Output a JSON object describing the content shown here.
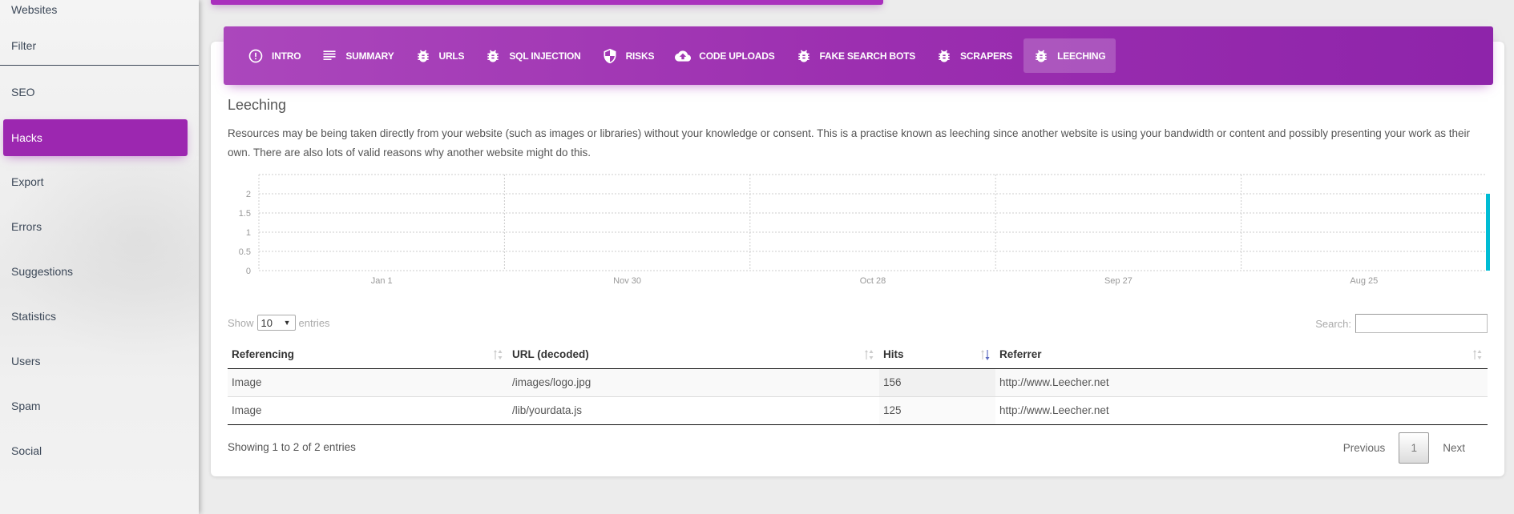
{
  "sidebar": {
    "items": [
      {
        "label": "Websites",
        "active": false
      },
      {
        "label": "Filter",
        "active": false
      },
      {
        "label": "SEO",
        "active": false
      },
      {
        "label": "Hacks",
        "active": true
      },
      {
        "label": "Export",
        "active": false
      },
      {
        "label": "Errors",
        "active": false
      },
      {
        "label": "Suggestions",
        "active": false
      },
      {
        "label": "Statistics",
        "active": false
      },
      {
        "label": "Users",
        "active": false
      },
      {
        "label": "Spam",
        "active": false
      },
      {
        "label": "Social",
        "active": false
      }
    ]
  },
  "tabs": [
    {
      "label": "INTRO",
      "icon": "info-circle-icon",
      "active": false
    },
    {
      "label": "SUMMARY",
      "icon": "list-lines-icon",
      "active": false
    },
    {
      "label": "URLS",
      "icon": "bug-icon",
      "active": false
    },
    {
      "label": "SQL INJECTION",
      "icon": "bug-icon",
      "active": false
    },
    {
      "label": "RISKS",
      "icon": "shield-icon",
      "active": false
    },
    {
      "label": "CODE UPLOADS",
      "icon": "cloud-upload-icon",
      "active": false
    },
    {
      "label": "FAKE SEARCH BOTS",
      "icon": "bug-icon",
      "active": false
    },
    {
      "label": "SCRAPERS",
      "icon": "bug-icon",
      "active": false
    },
    {
      "label": "LEECHING",
      "icon": "bug-icon",
      "active": true
    }
  ],
  "section": {
    "title": "Leeching",
    "description": "Resources may be being taken directly from your website (such as images or libraries) without your knowledge or consent. This is a practise known as leeching since another website is using your bandwidth or content and possibly presenting your work as their own. There are also lots of valid reasons why another website might do this."
  },
  "chart_data": {
    "type": "bar",
    "title": "",
    "xlabel": "",
    "ylabel": "",
    "x_tick_labels": [
      "Jan 1",
      "Nov 30",
      "Oct 28",
      "Sep 27",
      "Aug 25"
    ],
    "x_direction": "reverse-chronological (left to right)",
    "y_ticks": [
      0,
      0.5,
      1,
      1.5,
      2
    ],
    "ylim": [
      0,
      2.5
    ],
    "grid": true,
    "series": [
      {
        "name": "Leeching hits",
        "color": "#00bcd4",
        "points": [
          {
            "position": "right edge (oldest date)",
            "value": 2
          }
        ]
      }
    ]
  },
  "table": {
    "length_label_before": "Show",
    "length_value": "10",
    "length_label_after": "entries",
    "search_label": "Search:",
    "search_value": "",
    "columns": [
      {
        "label": "Referencing",
        "sort": "none"
      },
      {
        "label": "URL (decoded)",
        "sort": "none"
      },
      {
        "label": "Hits",
        "sort": "desc"
      },
      {
        "label": "Referrer",
        "sort": "none"
      }
    ],
    "rows": [
      [
        "Image",
        "/images/logo.jpg",
        "156",
        "http://www.Leecher.net"
      ],
      [
        "Image",
        "/lib/yourdata.js",
        "125",
        "http://www.Leecher.net"
      ]
    ],
    "info": "Showing 1 to 2 of 2 entries",
    "pagination": {
      "previous": "Previous",
      "current": "1",
      "next": "Next"
    }
  },
  "colors": {
    "accent": "#9c27b0",
    "chart_bar": "#00bcd4",
    "sort_active": "#5c6bc0"
  }
}
